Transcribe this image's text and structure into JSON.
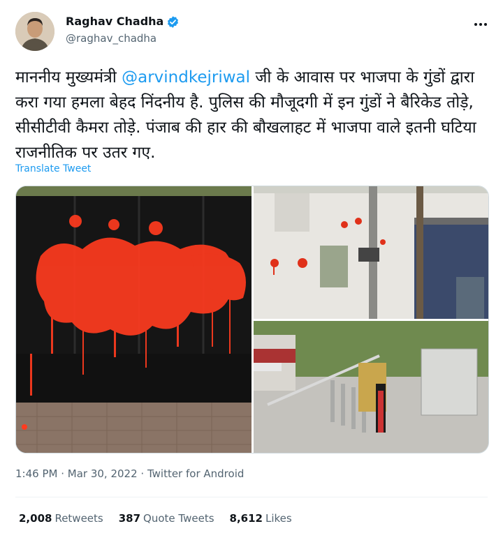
{
  "author": {
    "display_name": "Raghav Chadha",
    "handle": "@raghav_chadha"
  },
  "more_icon": "more-options-icon",
  "tweet": {
    "text_line1_pre": "माननीय मुख्यमंत्री ",
    "mention": "@arvindkejriwal",
    "text_line1_post": " जी के आवास पर भाजपा के गुंडों द्वारा करा गया हमला बेहद निंदनीय है. पुलिस की मौजूदगी में इन गुंडों ने बैरिकेड तोड़े, सीसीटीवी कैमरा तोड़े. पंजाब की हार की बौखलाहट में भाजपा वाले इतनी घटिया राजनीतिक पर उतर गए."
  },
  "translate_label": "Translate Tweet",
  "meta": {
    "time": "1:46 PM",
    "date": "Mar 30, 2022",
    "source": "Twitter for Android",
    "separator": " · "
  },
  "stats": {
    "retweets_count": "2,008",
    "retweets_label": "Retweets",
    "quotes_count": "387",
    "quotes_label": "Quote Tweets",
    "likes_count": "8,612",
    "likes_label": "Likes"
  },
  "colors": {
    "link": "#1d9bf0",
    "secondary": "#536471",
    "paint": "#ff3b1f"
  }
}
